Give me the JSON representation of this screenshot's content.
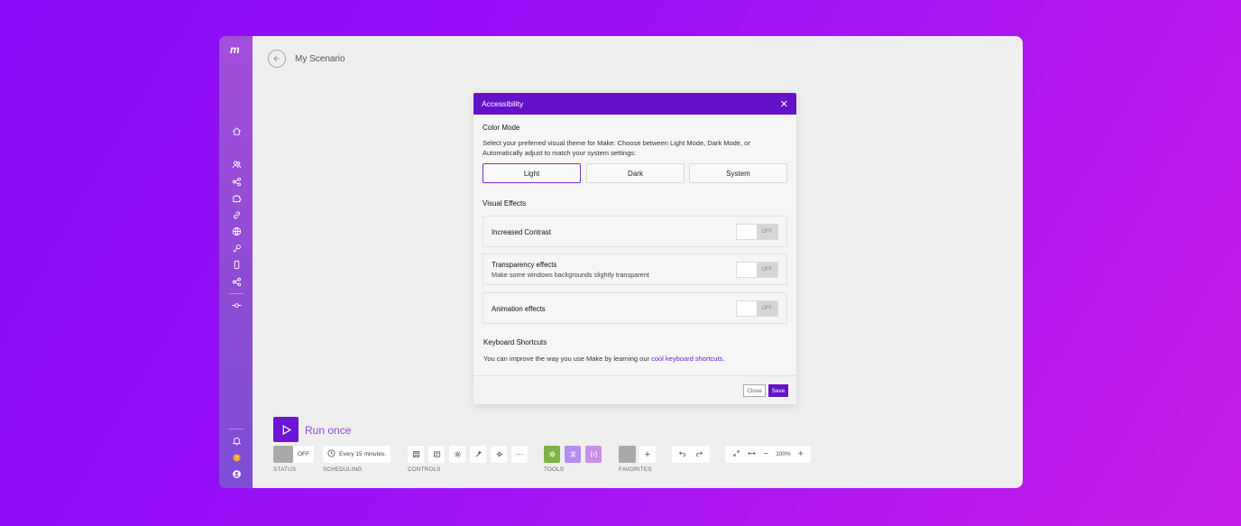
{
  "scenario": {
    "title": "My Scenario"
  },
  "modal": {
    "title": "Accessibility",
    "color_mode": {
      "heading": "Color Mode",
      "description": "Select your preferred visual theme for Make: Choose between Light Mode, Dark Mode, or Automatically adjust to match your system settings:",
      "options": [
        "Light",
        "Dark",
        "System"
      ],
      "selected": "Light"
    },
    "visual_effects": {
      "heading": "Visual Effects",
      "items": [
        {
          "label": "Increased Contrast",
          "sub": "",
          "state": "OFF"
        },
        {
          "label": "Transparency effects",
          "sub": "Make some windows backgrounds slightly transparent",
          "state": "OFF"
        },
        {
          "label": "Animation effects",
          "sub": "",
          "state": "OFF"
        }
      ]
    },
    "keyboard": {
      "heading": "Keyboard Shortcuts",
      "text_before": "You can improve the way you use Make by learning our ",
      "link": "cool keyboard shortcuts",
      "text_after": "."
    },
    "footer": {
      "close_label": "Close",
      "save_label": "Save"
    }
  },
  "toolbar": {
    "run_label": "Run once",
    "status_value": "OFF",
    "schedule_value": "Every 15 minutes.",
    "more_label": "···",
    "zoom_value": "100%",
    "labels": {
      "status": "STATUS",
      "scheduling": "SCHEDULING",
      "controls": "CONTROLS",
      "tools": "TOOLS",
      "favorites": "FAVORITES"
    }
  },
  "colors": {
    "brand": "#6312c9",
    "tool_green": "#7cb342",
    "tool_purple": "#b68cf0",
    "tool_pink": "#c98ee8"
  }
}
